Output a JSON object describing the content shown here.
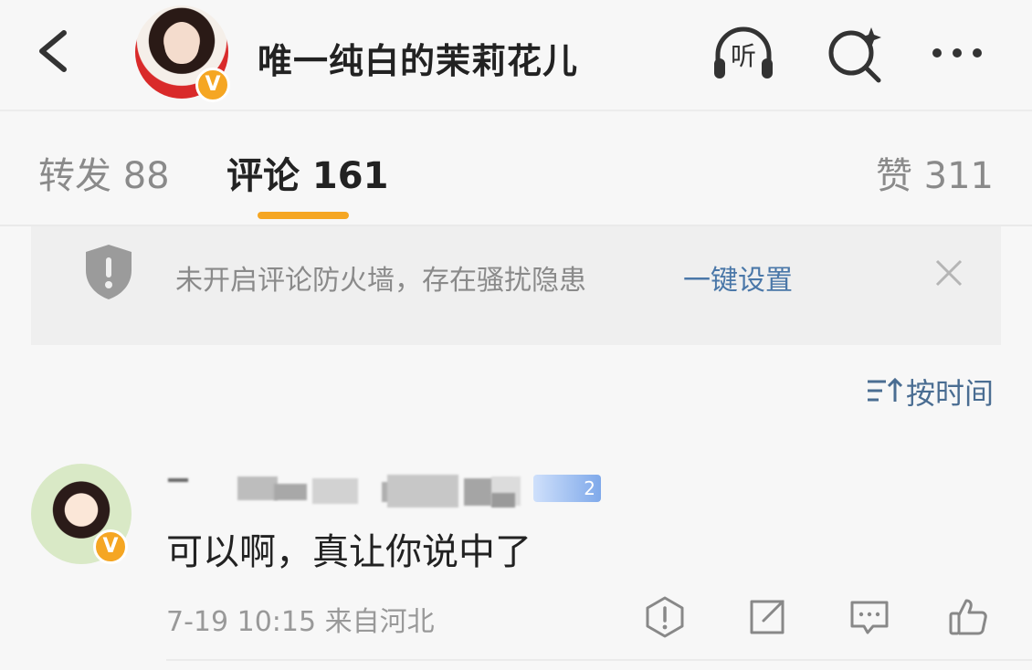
{
  "header": {
    "title": "唯一纯白的茉莉花儿",
    "verified_badge": "V",
    "listen_label": "听",
    "icons": [
      "back-icon",
      "listen-icon",
      "search-icon",
      "more-icon"
    ]
  },
  "tabs": [
    {
      "label": "转发 88"
    },
    {
      "label": "评论 161"
    },
    {
      "label": "赞 311"
    }
  ],
  "notice": {
    "text": "未开启评论防火墙，存在骚扰隐患",
    "link": "一键设置"
  },
  "sort": {
    "label": "按时间"
  },
  "comment": {
    "level": "2",
    "verified_badge": "V",
    "text": "可以啊，真让你说中了",
    "meta": "7-19 10:15 来自河北"
  },
  "colors": {
    "accent": "#f5a623",
    "link": "#4a77a8"
  }
}
